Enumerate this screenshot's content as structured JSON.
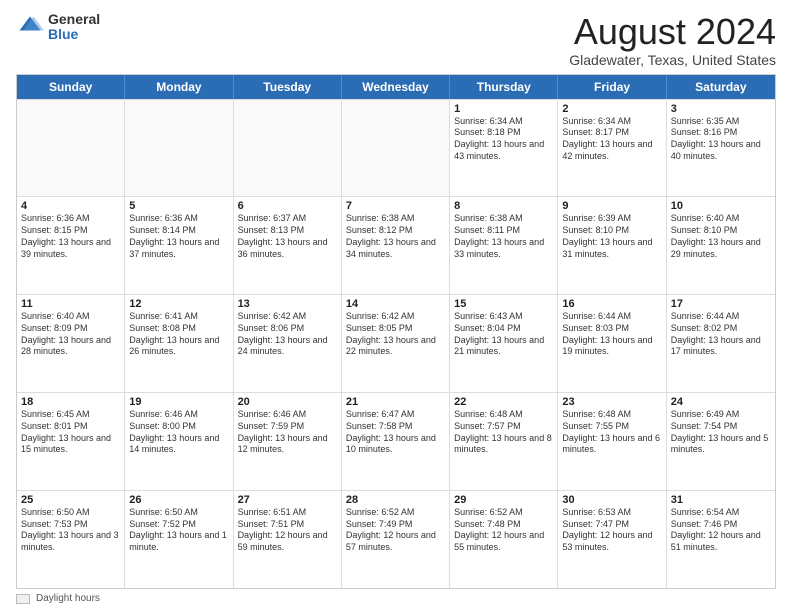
{
  "logo": {
    "general": "General",
    "blue": "Blue"
  },
  "title": "August 2024",
  "subtitle": "Gladewater, Texas, United States",
  "days_of_week": [
    "Sunday",
    "Monday",
    "Tuesday",
    "Wednesday",
    "Thursday",
    "Friday",
    "Saturday"
  ],
  "footer": {
    "label": "Daylight hours"
  },
  "weeks": [
    [
      {
        "day": "",
        "empty": true
      },
      {
        "day": "",
        "empty": true
      },
      {
        "day": "",
        "empty": true
      },
      {
        "day": "",
        "empty": true
      },
      {
        "day": "1",
        "sunrise": "Sunrise: 6:34 AM",
        "sunset": "Sunset: 8:18 PM",
        "daylight": "Daylight: 13 hours and 43 minutes."
      },
      {
        "day": "2",
        "sunrise": "Sunrise: 6:34 AM",
        "sunset": "Sunset: 8:17 PM",
        "daylight": "Daylight: 13 hours and 42 minutes."
      },
      {
        "day": "3",
        "sunrise": "Sunrise: 6:35 AM",
        "sunset": "Sunset: 8:16 PM",
        "daylight": "Daylight: 13 hours and 40 minutes."
      }
    ],
    [
      {
        "day": "4",
        "sunrise": "Sunrise: 6:36 AM",
        "sunset": "Sunset: 8:15 PM",
        "daylight": "Daylight: 13 hours and 39 minutes."
      },
      {
        "day": "5",
        "sunrise": "Sunrise: 6:36 AM",
        "sunset": "Sunset: 8:14 PM",
        "daylight": "Daylight: 13 hours and 37 minutes."
      },
      {
        "day": "6",
        "sunrise": "Sunrise: 6:37 AM",
        "sunset": "Sunset: 8:13 PM",
        "daylight": "Daylight: 13 hours and 36 minutes."
      },
      {
        "day": "7",
        "sunrise": "Sunrise: 6:38 AM",
        "sunset": "Sunset: 8:12 PM",
        "daylight": "Daylight: 13 hours and 34 minutes."
      },
      {
        "day": "8",
        "sunrise": "Sunrise: 6:38 AM",
        "sunset": "Sunset: 8:11 PM",
        "daylight": "Daylight: 13 hours and 33 minutes."
      },
      {
        "day": "9",
        "sunrise": "Sunrise: 6:39 AM",
        "sunset": "Sunset: 8:10 PM",
        "daylight": "Daylight: 13 hours and 31 minutes."
      },
      {
        "day": "10",
        "sunrise": "Sunrise: 6:40 AM",
        "sunset": "Sunset: 8:10 PM",
        "daylight": "Daylight: 13 hours and 29 minutes."
      }
    ],
    [
      {
        "day": "11",
        "sunrise": "Sunrise: 6:40 AM",
        "sunset": "Sunset: 8:09 PM",
        "daylight": "Daylight: 13 hours and 28 minutes."
      },
      {
        "day": "12",
        "sunrise": "Sunrise: 6:41 AM",
        "sunset": "Sunset: 8:08 PM",
        "daylight": "Daylight: 13 hours and 26 minutes."
      },
      {
        "day": "13",
        "sunrise": "Sunrise: 6:42 AM",
        "sunset": "Sunset: 8:06 PM",
        "daylight": "Daylight: 13 hours and 24 minutes."
      },
      {
        "day": "14",
        "sunrise": "Sunrise: 6:42 AM",
        "sunset": "Sunset: 8:05 PM",
        "daylight": "Daylight: 13 hours and 22 minutes."
      },
      {
        "day": "15",
        "sunrise": "Sunrise: 6:43 AM",
        "sunset": "Sunset: 8:04 PM",
        "daylight": "Daylight: 13 hours and 21 minutes."
      },
      {
        "day": "16",
        "sunrise": "Sunrise: 6:44 AM",
        "sunset": "Sunset: 8:03 PM",
        "daylight": "Daylight: 13 hours and 19 minutes."
      },
      {
        "day": "17",
        "sunrise": "Sunrise: 6:44 AM",
        "sunset": "Sunset: 8:02 PM",
        "daylight": "Daylight: 13 hours and 17 minutes."
      }
    ],
    [
      {
        "day": "18",
        "sunrise": "Sunrise: 6:45 AM",
        "sunset": "Sunset: 8:01 PM",
        "daylight": "Daylight: 13 hours and 15 minutes."
      },
      {
        "day": "19",
        "sunrise": "Sunrise: 6:46 AM",
        "sunset": "Sunset: 8:00 PM",
        "daylight": "Daylight: 13 hours and 14 minutes."
      },
      {
        "day": "20",
        "sunrise": "Sunrise: 6:46 AM",
        "sunset": "Sunset: 7:59 PM",
        "daylight": "Daylight: 13 hours and 12 minutes."
      },
      {
        "day": "21",
        "sunrise": "Sunrise: 6:47 AM",
        "sunset": "Sunset: 7:58 PM",
        "daylight": "Daylight: 13 hours and 10 minutes."
      },
      {
        "day": "22",
        "sunrise": "Sunrise: 6:48 AM",
        "sunset": "Sunset: 7:57 PM",
        "daylight": "Daylight: 13 hours and 8 minutes."
      },
      {
        "day": "23",
        "sunrise": "Sunrise: 6:48 AM",
        "sunset": "Sunset: 7:55 PM",
        "daylight": "Daylight: 13 hours and 6 minutes."
      },
      {
        "day": "24",
        "sunrise": "Sunrise: 6:49 AM",
        "sunset": "Sunset: 7:54 PM",
        "daylight": "Daylight: 13 hours and 5 minutes."
      }
    ],
    [
      {
        "day": "25",
        "sunrise": "Sunrise: 6:50 AM",
        "sunset": "Sunset: 7:53 PM",
        "daylight": "Daylight: 13 hours and 3 minutes."
      },
      {
        "day": "26",
        "sunrise": "Sunrise: 6:50 AM",
        "sunset": "Sunset: 7:52 PM",
        "daylight": "Daylight: 13 hours and 1 minute."
      },
      {
        "day": "27",
        "sunrise": "Sunrise: 6:51 AM",
        "sunset": "Sunset: 7:51 PM",
        "daylight": "Daylight: 12 hours and 59 minutes."
      },
      {
        "day": "28",
        "sunrise": "Sunrise: 6:52 AM",
        "sunset": "Sunset: 7:49 PM",
        "daylight": "Daylight: 12 hours and 57 minutes."
      },
      {
        "day": "29",
        "sunrise": "Sunrise: 6:52 AM",
        "sunset": "Sunset: 7:48 PM",
        "daylight": "Daylight: 12 hours and 55 minutes."
      },
      {
        "day": "30",
        "sunrise": "Sunrise: 6:53 AM",
        "sunset": "Sunset: 7:47 PM",
        "daylight": "Daylight: 12 hours and 53 minutes."
      },
      {
        "day": "31",
        "sunrise": "Sunrise: 6:54 AM",
        "sunset": "Sunset: 7:46 PM",
        "daylight": "Daylight: 12 hours and 51 minutes."
      }
    ]
  ]
}
